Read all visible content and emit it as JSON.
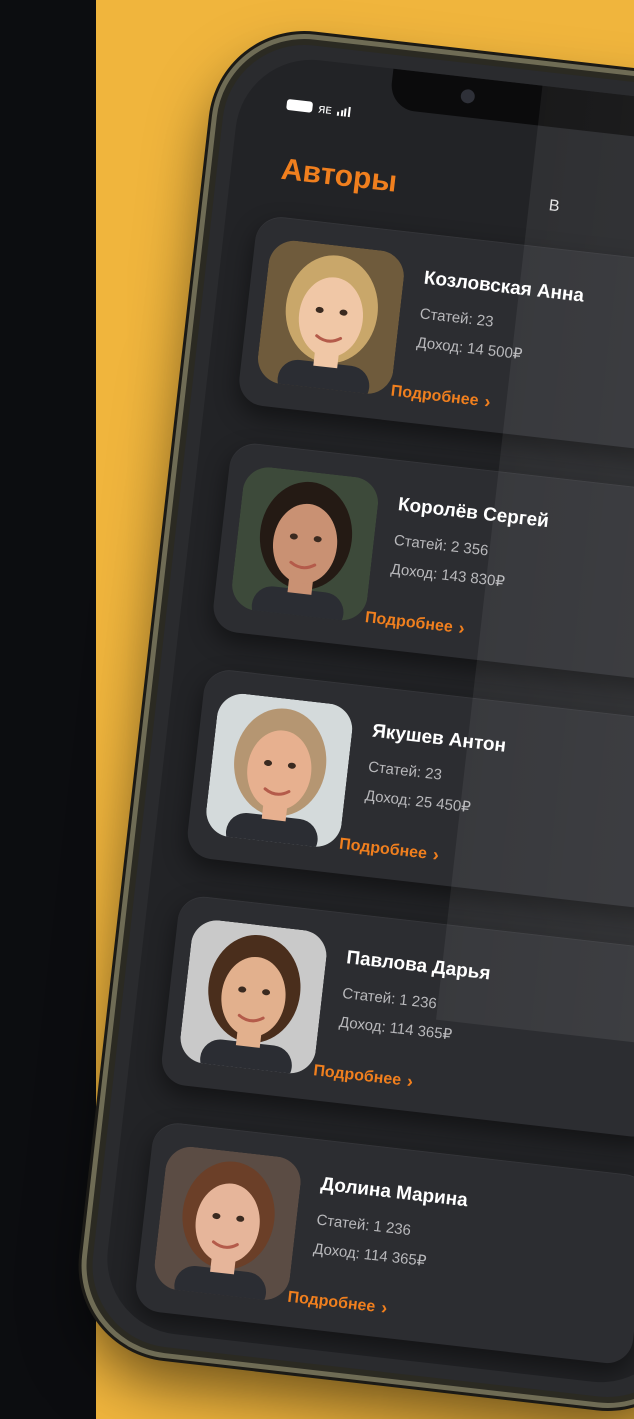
{
  "status": {
    "battery_icon": "battery-icon",
    "carrier": "ᴙᴇ",
    "signal_icon": "signal-icon"
  },
  "header": {
    "title": "Авторы",
    "right_hint": "В"
  },
  "authors": [
    {
      "name": "Козловская Анна",
      "articles": "Статей: 23",
      "income": "Доход: 14 500₽",
      "more": "Подробнее",
      "hair": "#c9a76a",
      "skin": "#f0c7a6",
      "bg": "#6f5b3c"
    },
    {
      "name": "Королёв Сергей",
      "articles": "Статей: 2 356",
      "income": "Доход: 143 830₽",
      "more": "Подробнее",
      "hair": "#241a14",
      "skin": "#c99173",
      "bg": "#3d4a3a"
    },
    {
      "name": "Якушев Антон",
      "articles": "Статей: 23",
      "income": "Доход: 25 450₽",
      "more": "Подробнее",
      "hair": "#b59672",
      "skin": "#e7b08f",
      "bg": "#d4dadb"
    },
    {
      "name": "Павлова Дарья",
      "articles": "Статей: 1 236",
      "income": "Доход: 114 365₽",
      "more": "Подробнее",
      "hair": "#4a2e1c",
      "skin": "#e2b08d",
      "bg": "#c9c9c9"
    },
    {
      "name": "Долина Марина",
      "articles": "Статей: 1 236",
      "income": "Доход: 114 365₽",
      "more": "Подробнее",
      "hair": "#6b3f28",
      "skin": "#e6b59a",
      "bg": "#5b4c44"
    }
  ],
  "colors": {
    "accent": "#f07f1e",
    "bg_yellow": "#f0b53d",
    "card": "#2c2d31",
    "screen": "#222326"
  }
}
